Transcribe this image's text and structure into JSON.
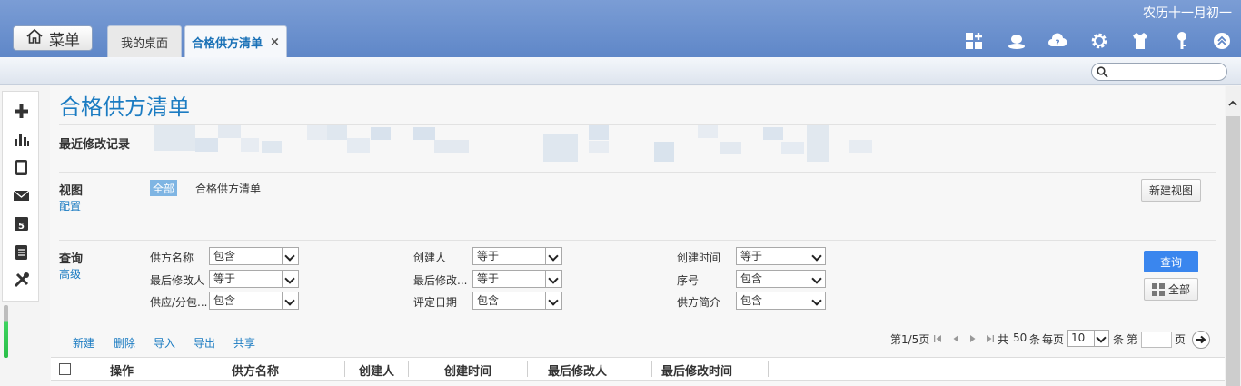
{
  "header": {
    "lunar_date": "农历十一月初一",
    "menu_label": "菜单",
    "tabs": [
      {
        "label": "我的桌面",
        "active": false
      },
      {
        "label": "合格供方清单",
        "active": true
      }
    ],
    "tab_close": "×",
    "toolbar_icons": [
      "add-widget-icon",
      "user-icon",
      "cloud-help-icon",
      "gear-icon",
      "shirt-icon",
      "key-icon",
      "collapse-up-icon"
    ]
  },
  "search": {
    "placeholder": ""
  },
  "leftbar_icons": [
    "plus-icon",
    "bar-chart-icon",
    "tablet-icon",
    "mail-icon",
    "calendar-icon",
    "clipboard-icon",
    "tools-icon"
  ],
  "page": {
    "title": "合格供方清单",
    "recent_label": "最近修改记录",
    "view": {
      "label": "视图",
      "config_link": "配置",
      "all_badge": "全部",
      "view_name": "合格供方清单",
      "new_view_button": "新建视图"
    },
    "query": {
      "label": "查询",
      "advanced_link": "高级",
      "fields": [
        [
          {
            "label": "供方名称",
            "value": "包含"
          },
          {
            "label": "创建人",
            "value": "等于"
          },
          {
            "label": "创建时间",
            "value": "等于"
          }
        ],
        [
          {
            "label": "最后修改人",
            "value": "等于"
          },
          {
            "label": "最后修改...",
            "value": "等于"
          },
          {
            "label": "序号",
            "value": "包含"
          }
        ],
        [
          {
            "label": "供应/分包...",
            "value": "包含"
          },
          {
            "label": "评定日期",
            "value": "包含"
          },
          {
            "label": "供方简介",
            "value": "包含"
          }
        ]
      ],
      "search_button": "查询",
      "all_button": "全部"
    },
    "actions": [
      "新建",
      "删除",
      "导入",
      "导出",
      "共享"
    ],
    "pager": {
      "page_info": "第1/5页",
      "total_prefix": "共",
      "total": "50",
      "total_suffix": "条",
      "per_page_label": "每页",
      "per_page": "10",
      "per_page_suffix": "条",
      "goto_prefix": "第",
      "goto_suffix": "页"
    },
    "table": {
      "columns": [
        "操作",
        "供方名称",
        "创建人",
        "创建时间",
        "最后修改人",
        "最后修改时间"
      ]
    }
  }
}
